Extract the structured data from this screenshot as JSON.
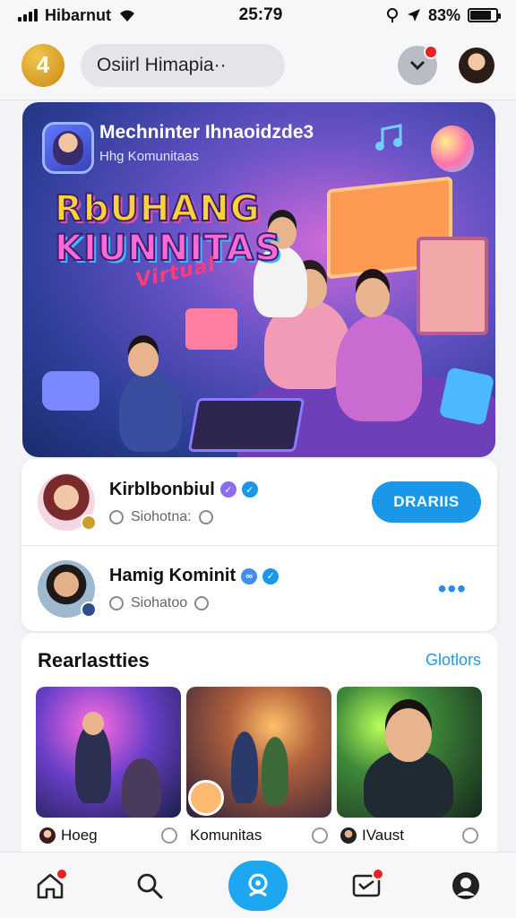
{
  "status_bar": {
    "carrier": "Hibarnut",
    "time": "25:79",
    "battery": "83%",
    "battery_level": 0.83
  },
  "header": {
    "logo_text": "4",
    "search_text": "Osiirl Himapia··",
    "icons": [
      "bell-chevron-icon",
      "user-avatar"
    ]
  },
  "hero": {
    "title": "Mechninter Ihnaoidzde3",
    "subtitle": "Hhg Komunitaas",
    "line1": "RbUHANG",
    "line2": "KIUNNITAS",
    "line3": "Virtual"
  },
  "profiles": [
    {
      "name": "Kirblbonbiul",
      "meta": "Siohotna:",
      "action": "DRARIIS",
      "badges": [
        "purple",
        "blue"
      ]
    },
    {
      "name": "Hamig Kominit",
      "meta": "Siohatoo",
      "action": "•••",
      "badges": [
        "blue",
        "blue"
      ]
    }
  ],
  "section": {
    "title": "Rearlastties",
    "link": "Glotlors",
    "cards": [
      {
        "caption": "Hoeg"
      },
      {
        "caption": "Komunitas"
      },
      {
        "caption": "IVaust"
      }
    ]
  },
  "nav": [
    "home-icon",
    "search-icon",
    "community-icon",
    "messages-icon",
    "profile-icon"
  ],
  "colors": {
    "primary": "#1a97e8",
    "accent_red": "#e52323",
    "logo_gold": "#d39a1d"
  }
}
